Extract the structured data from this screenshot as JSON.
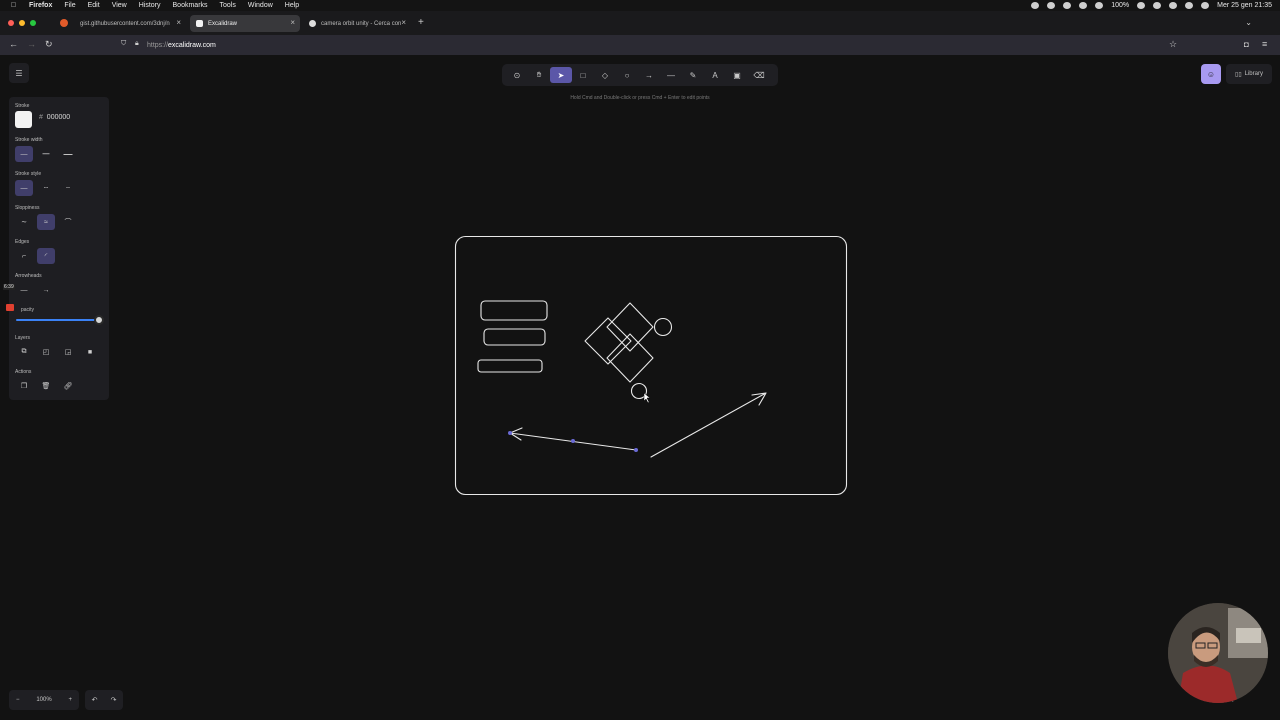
{
  "menubar": {
    "app": "Firefox",
    "items": [
      "File",
      "Edit",
      "View",
      "History",
      "Bookmarks",
      "Tools",
      "Window",
      "Help"
    ],
    "battery": "100%",
    "clock": "Mer 25 gen 21:35"
  },
  "tabs": [
    {
      "label": "gist.githubusercontent.com/3dnj/n",
      "active": false
    },
    {
      "label": "Excalidraw",
      "active": true
    },
    {
      "label": "camera orbit unity - Cerca con",
      "active": false
    }
  ],
  "urlbar": {
    "scheme": "https://",
    "host": "excalidraw.com"
  },
  "toolbar": {
    "tools": [
      "lock",
      "hand",
      "selection",
      "rectangle",
      "diamond",
      "ellipse",
      "arrow",
      "line",
      "draw",
      "text",
      "image",
      "eraser"
    ],
    "active_tool": "selection",
    "hint": "Hold Cmd and Double-click or press Cmd + Enter to edit points"
  },
  "library": {
    "label": "Library"
  },
  "panel": {
    "stroke_label": "Stroke",
    "stroke_hex_prefix": "#",
    "stroke_hex": "000000",
    "stroke_width_label": "Stroke width",
    "stroke_style_label": "Stroke style",
    "sloppiness_label": "Sloppiness",
    "edges_label": "Edges",
    "arrowheads_label": "Arrowheads",
    "opacity_label": "pacity",
    "opacity_value": 1.0,
    "layers_label": "Layers",
    "actions_label": "Actions",
    "timestamp": "6:39"
  },
  "footer": {
    "zoom": "100%",
    "zoom_out": "−",
    "zoom_in": "+",
    "undo": "↶",
    "redo": "↷",
    "help": "?"
  },
  "colors": {
    "accent": "#5b57a8",
    "collab": "#a89af1",
    "canvas": "#121212",
    "stroke": "#e8e8e8"
  }
}
